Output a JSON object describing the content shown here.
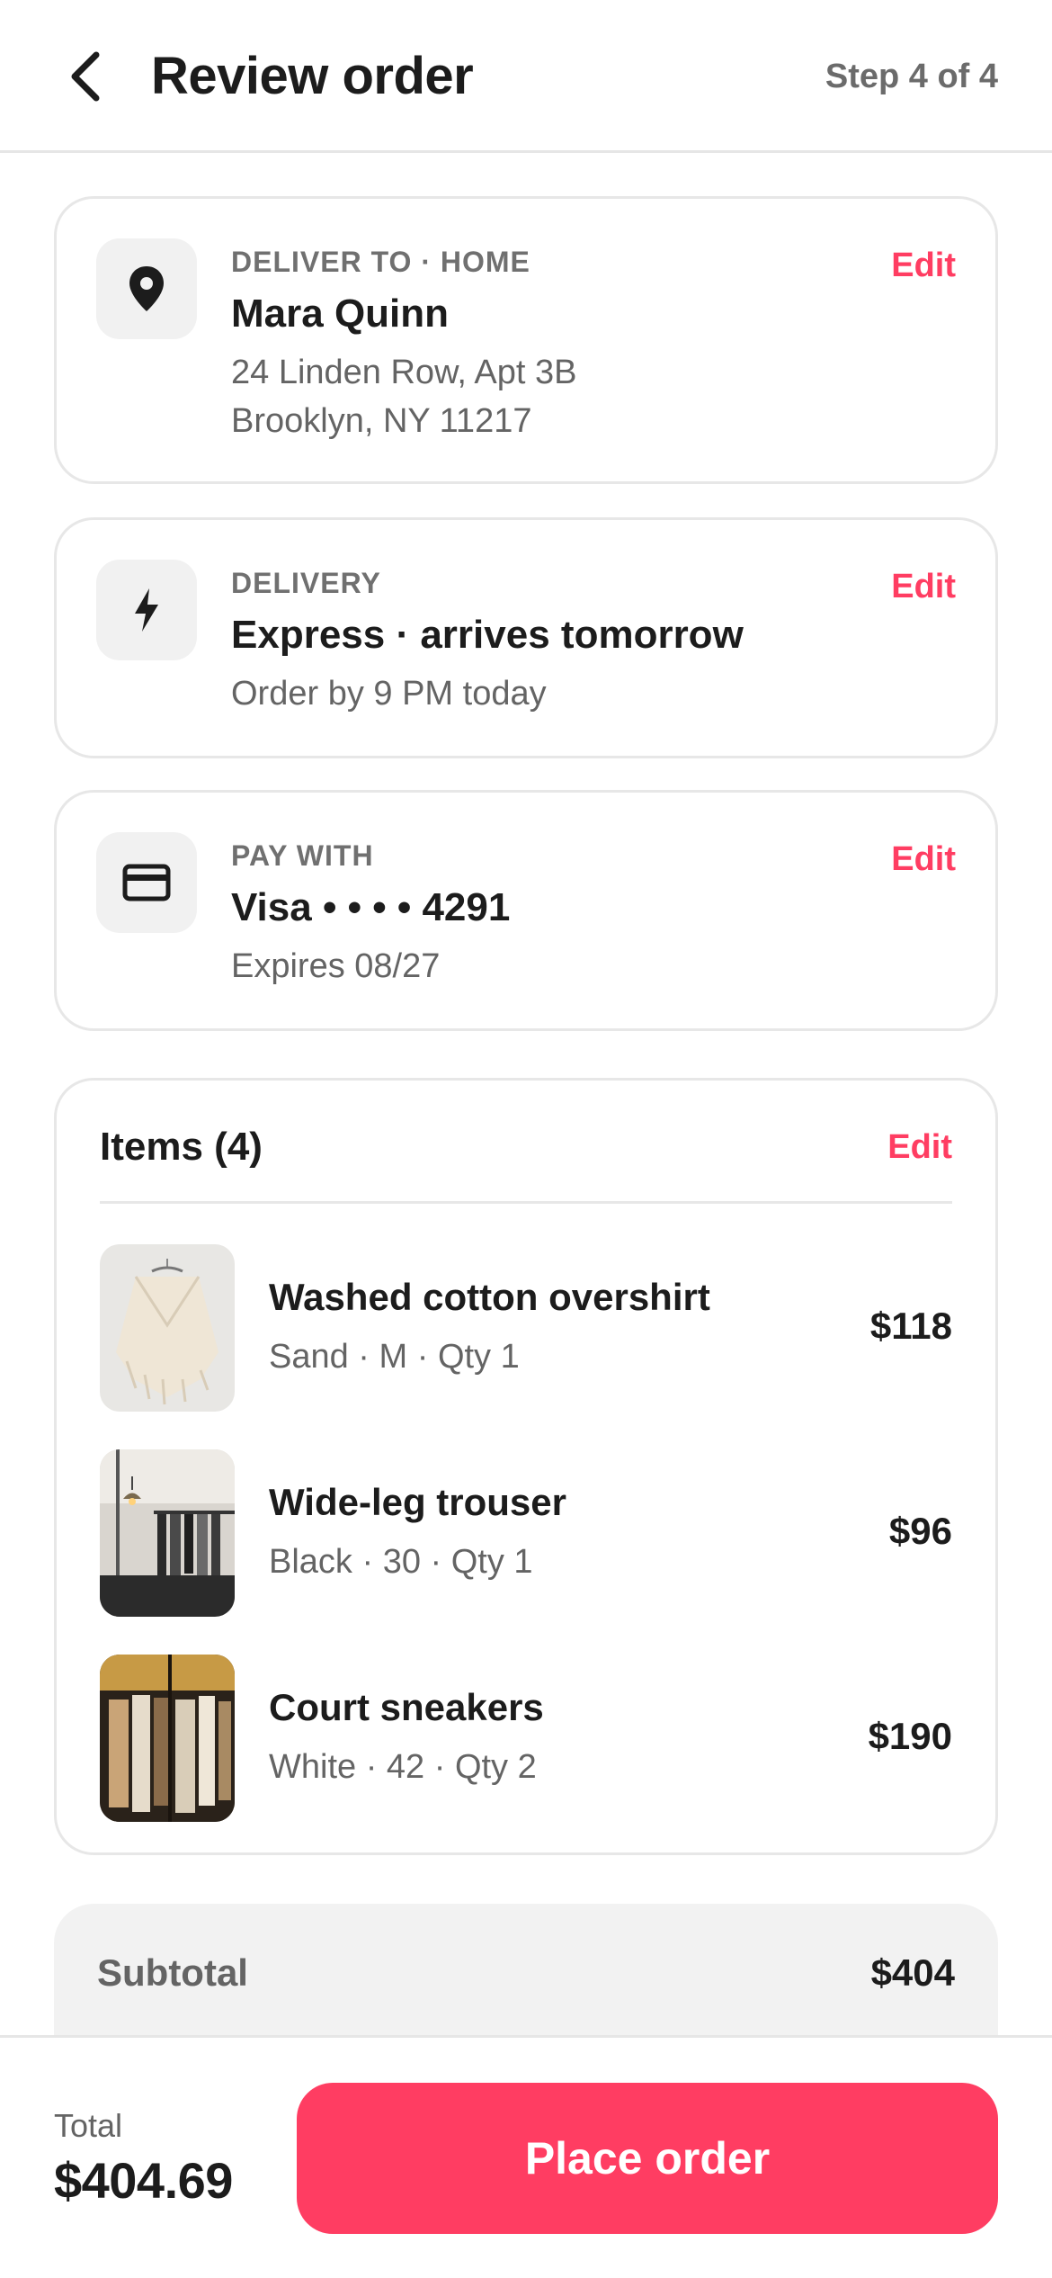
{
  "header": {
    "title": "Review order",
    "step": "Step 4 of 4"
  },
  "address": {
    "label": "DELIVER TO · HOME",
    "name": "Mara Quinn",
    "line1": "24 Linden Row, Apt 3B",
    "line2": "Brooklyn, NY 11217",
    "edit": "Edit",
    "icon": "location-pin-icon"
  },
  "delivery": {
    "label": "DELIVERY",
    "title": "Express · arrives tomorrow",
    "sub": "Order by 9 PM today",
    "edit": "Edit",
    "icon": "lightning-icon"
  },
  "payment": {
    "label": "PAY WITH",
    "title": "Visa • • • • 4291",
    "sub": "Expires 08/27",
    "edit": "Edit",
    "icon": "credit-card-icon"
  },
  "items": {
    "title": "Items (4)",
    "edit": "Edit",
    "list": [
      {
        "name": "Washed cotton overshirt",
        "meta": "Sand · M  ·  Qty 1",
        "price": "$118"
      },
      {
        "name": "Wide-leg trouser",
        "meta": "Black · 30  ·  Qty 1",
        "price": "$96"
      },
      {
        "name": "Court sneakers",
        "meta": "White · 42  ·  Qty 2",
        "price": "$190"
      }
    ]
  },
  "summary": {
    "subtotal_label": "Subtotal",
    "subtotal_value": "$404"
  },
  "footer": {
    "total_label": "Total",
    "total_value": "$404.69",
    "place_order": "Place order"
  },
  "colors": {
    "accent": "#ff3d62",
    "text": "#1c1c1c",
    "muted": "#646464"
  }
}
